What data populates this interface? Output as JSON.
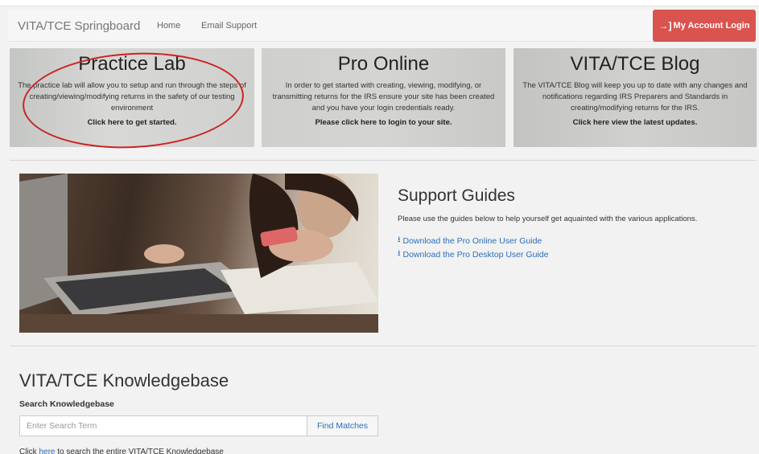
{
  "navbar": {
    "brand": "VITA/TCE Springboard",
    "links": [
      "Home",
      "Email Support"
    ],
    "login_label": "My Account Login",
    "login_color": "#d9534f"
  },
  "panels": [
    {
      "title": "Practice Lab",
      "text": "The practice lab will allow you to setup and run through the steps of creating/viewing/modifying returns in the safety of our testing environment",
      "cta": "Click here to get started."
    },
    {
      "title": "Pro Online",
      "text": "In order to get started with creating, viewing, modifying, or transmitting returns for the IRS ensure your site has been created and you have your login credentials ready.",
      "cta": "Please click here to login to your site."
    },
    {
      "title": "VITA/TCE Blog",
      "text": "The VITA/TCE Blog will keep you up to date with any changes and notifications regarding IRS Preparers and Standards in creating/modifying returns for the IRS.",
      "cta": "Click here view the latest updates."
    }
  ],
  "support": {
    "title": "Support Guides",
    "description": "Please use the guides below to help yourself get aquainted with the various applications.",
    "links": [
      "Download the Pro Online User Guide",
      "Download the Pro Desktop User Guide"
    ]
  },
  "knowledgebase": {
    "title": "VITA/TCE Knowledgebase",
    "search_label": "Search Knowledgebase",
    "search_placeholder": "Enter Search Term",
    "button_label": "Find Matches",
    "footer_prefix": "Click ",
    "footer_link": "here",
    "footer_suffix": " to search the entire VITA/TCE Knowledgebase"
  },
  "colors": {
    "link": "#2a6ebb",
    "annotation": "#cc2222"
  }
}
